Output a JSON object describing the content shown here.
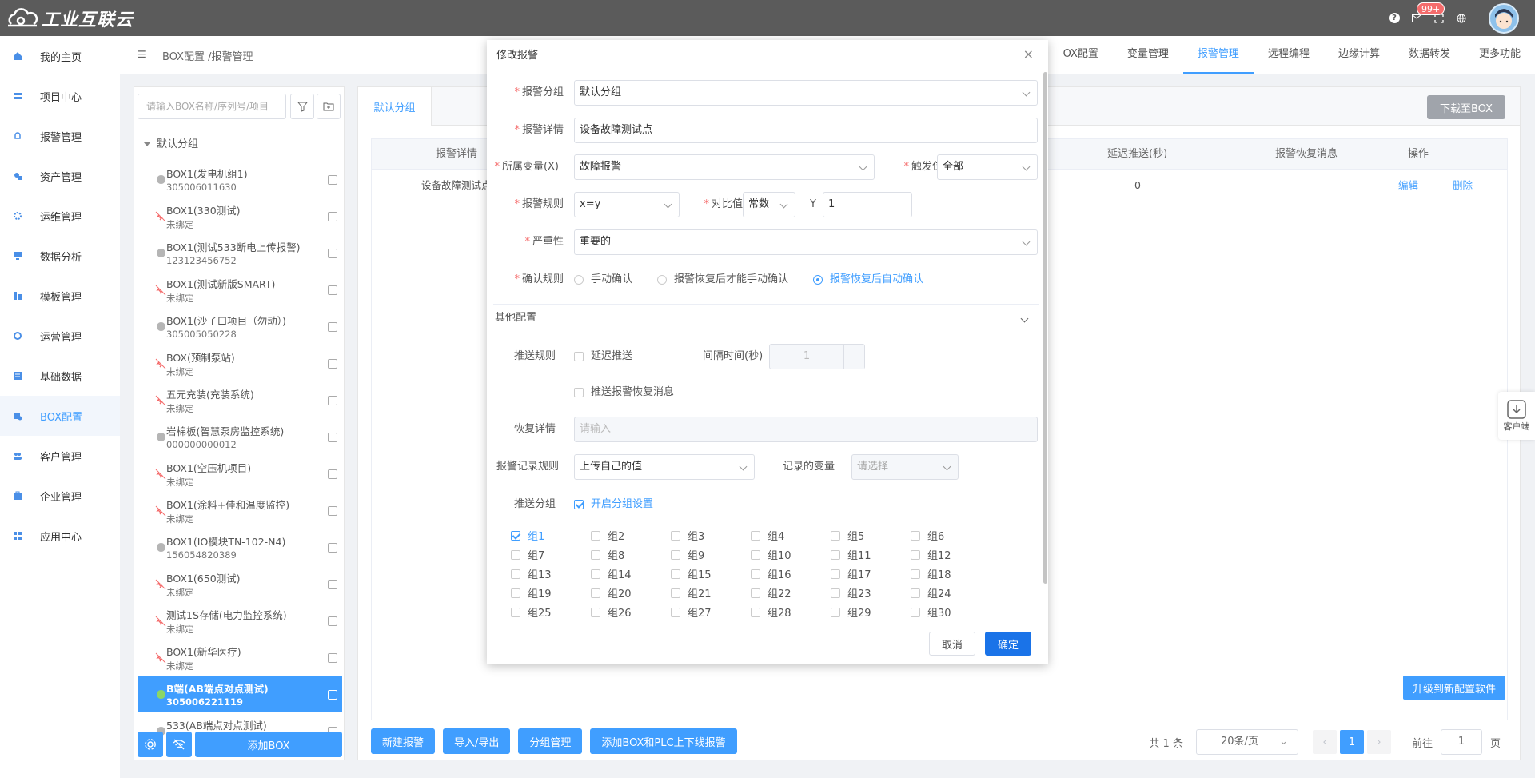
{
  "app": {
    "logo_text": "工业互联云",
    "notification_count": "99+",
    "help_glyph": "?"
  },
  "nav": {
    "items": [
      {
        "label": "我的主页",
        "icon": "home-icon"
      },
      {
        "label": "项目中心",
        "icon": "project-icon"
      },
      {
        "label": "报警管理",
        "icon": "bell-icon"
      },
      {
        "label": "资产管理",
        "icon": "asset-icon"
      },
      {
        "label": "运维管理",
        "icon": "gear-icon"
      },
      {
        "label": "数据分析",
        "icon": "monitor-icon"
      },
      {
        "label": "模板管理",
        "icon": "template-icon"
      },
      {
        "label": "运营管理",
        "icon": "operation-icon"
      },
      {
        "label": "基础数据",
        "icon": "database-icon"
      },
      {
        "label": "BOX配置",
        "icon": "box-icon",
        "active": true
      },
      {
        "label": "客户管理",
        "icon": "users-icon"
      },
      {
        "label": "企业管理",
        "icon": "briefcase-icon"
      },
      {
        "label": "应用中心",
        "icon": "apps-icon"
      }
    ]
  },
  "breadcrumb": "BOX配置 /报警管理",
  "top_tabs": [
    {
      "label": "OX配置"
    },
    {
      "label": "变量管理"
    },
    {
      "label": "报警管理",
      "active": true
    },
    {
      "label": "远程编程"
    },
    {
      "label": "边缘计算"
    },
    {
      "label": "数据转发"
    },
    {
      "label": "更多功能"
    }
  ],
  "tree": {
    "search_placeholder": "请输入BOX名称/序列号/项目",
    "group_label": "默认分组",
    "items": [
      {
        "name": "BOX1(发电机组1)",
        "sub": "305006011630",
        "status": "offline"
      },
      {
        "name": "BOX1(330测试)",
        "sub": "未绑定",
        "status": "unbound"
      },
      {
        "name": "BOX1(测试533断电上传报警)",
        "sub": "123123456752",
        "status": "offline"
      },
      {
        "name": "BOX1(测试新版SMART)",
        "sub": "未绑定",
        "status": "unbound"
      },
      {
        "name": "BOX1(沙子口项目（勿动）)",
        "sub": "305005050228",
        "status": "offline"
      },
      {
        "name": "BOX(预制泵站)",
        "sub": "未绑定",
        "status": "unbound"
      },
      {
        "name": "五元充装(充装系统)",
        "sub": "未绑定",
        "status": "unbound"
      },
      {
        "name": "岩棉板(智慧泵房监控系统)",
        "sub": "000000000012",
        "status": "offline"
      },
      {
        "name": "BOX1(空压机项目)",
        "sub": "未绑定",
        "status": "unbound"
      },
      {
        "name": "BOX1(涂料+佳和温度监控)",
        "sub": "未绑定",
        "status": "unbound"
      },
      {
        "name": "BOX1(IO模块TN-102-N4)",
        "sub": "156054820389",
        "status": "offline"
      },
      {
        "name": "BOX1(650测试)",
        "sub": "未绑定",
        "status": "unbound"
      },
      {
        "name": "测试1S存储(电力监控系统)",
        "sub": "未绑定",
        "status": "unbound"
      },
      {
        "name": "BOX1(新华医疗)",
        "sub": "未绑定",
        "status": "unbound"
      },
      {
        "name": "B端(AB端点对点测试)",
        "sub": "305006221119",
        "status": "online",
        "selected": true
      },
      {
        "name": "533(AB端点对点测试)",
        "sub": "",
        "status": "offline"
      }
    ],
    "add_box_label": "添加BOX"
  },
  "main": {
    "tab_label": "默认分组",
    "download_label": "下载至BOX",
    "table": {
      "headers": {
        "detail": "报警详情",
        "delay": "延迟推送(秒)",
        "recover": "报警恢复消息",
        "ops": "操作"
      },
      "row": {
        "detail": "设备故障测试点",
        "delay": "0",
        "recover": "",
        "edit": "编辑",
        "delete": "删除"
      }
    },
    "upgrade_label": "升级到新配置软件",
    "buttons": [
      "新建报警",
      "导入/导出",
      "分组管理",
      "添加BOX和PLC上下线报警"
    ],
    "pager": {
      "total": "共 1 条",
      "page_size": "20条/页",
      "current": "1",
      "goto_label": "前往",
      "goto_value": "1",
      "page_suffix": "页"
    }
  },
  "customer_float": "客户端",
  "dialog": {
    "title": "修改报警",
    "fields": {
      "group_label": "报警分组",
      "group_value": "默认分组",
      "detail_label": "报警详情",
      "detail_value": "设备故障测试点",
      "var_label": "所属变量(X)",
      "var_value": "故障报警",
      "trigger_label": "触发位",
      "trigger_value": "全部",
      "rule_label": "报警规则",
      "rule_value": "x=y",
      "compare_label": "对比值",
      "compare_type": "常数",
      "compare_y": "Y",
      "compare_value": "1",
      "severity_label": "严重性",
      "severity_value": "重要的",
      "confirm_label": "确认规则",
      "confirm_options": [
        "手动确认",
        "报警恢复后才能手动确认",
        "报警恢复后自动确认"
      ],
      "confirm_selected": 2
    },
    "other": {
      "section_label": "其他配置",
      "push_rule_label": "推送规则",
      "delay_push_label": "延迟推送",
      "interval_label": "间隔时间(秒)",
      "interval_value": "1",
      "push_recover_label": "推送报警恢复消息",
      "recover_detail_label": "恢复详情",
      "recover_detail_placeholder": "请输入",
      "record_rule_label": "报警记录规则",
      "record_rule_value": "上传自己的值",
      "record_var_label": "记录的变量",
      "record_var_placeholder": "请选择",
      "push_group_label": "推送分组",
      "enable_group_label": "开启分组设置"
    },
    "groups": [
      "组1",
      "组2",
      "组3",
      "组4",
      "组5",
      "组6",
      "组7",
      "组8",
      "组9",
      "组10",
      "组11",
      "组12",
      "组13",
      "组14",
      "组15",
      "组16",
      "组17",
      "组18",
      "组19",
      "组20",
      "组21",
      "组22",
      "组23",
      "组24",
      "组25",
      "组26",
      "组27",
      "组28",
      "组29",
      "组30"
    ],
    "groups_checked": [
      "组1"
    ],
    "cancel_label": "取消",
    "ok_label": "确定"
  },
  "colors": {
    "primary": "#409eff",
    "topbar": "#5b5b5b",
    "badge": "#f56c6c"
  }
}
